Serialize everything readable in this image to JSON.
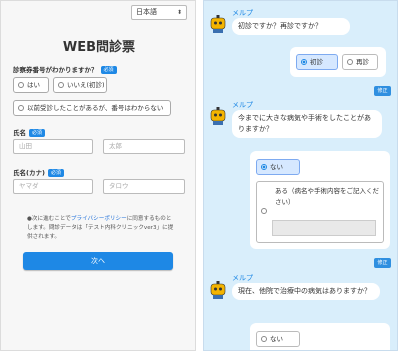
{
  "form": {
    "language": "日本語",
    "title": "WEB問診票",
    "q_card": {
      "label": "診察券番号がわかりますか？",
      "badge": "必須",
      "opt_yes": "はい",
      "opt_no": "いいえ(初診)",
      "opt_unknown": "以前受診したことがあるが、番号はわからない"
    },
    "name": {
      "label": "氏名",
      "badge": "必須",
      "last_placeholder": "山田",
      "first_placeholder": "太郎"
    },
    "kana": {
      "label": "氏名(カナ)",
      "badge": "必須",
      "last_placeholder": "ヤマダ",
      "first_placeholder": "タロウ"
    },
    "note": {
      "prefix": "●次に進むことで",
      "link": "プライバシーポリシー",
      "suffix": "に同意するものとします。問診データは「テスト内科クリニックver3」に提供されます。"
    },
    "next_label": "次へ"
  },
  "chat": {
    "bot_name": "メルプ",
    "fix_label": "修正",
    "q1": {
      "text": "初診ですか？再診ですか？",
      "opt1": "初診",
      "opt2": "再診"
    },
    "q2": {
      "text": "今までに大きな病気や手術をしたことがありますか？",
      "opt1": "ない",
      "opt2": "ある（病名や手術内容をご記入ください）"
    },
    "q3": {
      "text": "現在、他院で治療中の病気はありますか？",
      "opt1": "ない"
    },
    "colors": {
      "accent": "#1e88e5",
      "chat_bg": "#d9eefb",
      "selected": "#d6e8ff"
    }
  }
}
